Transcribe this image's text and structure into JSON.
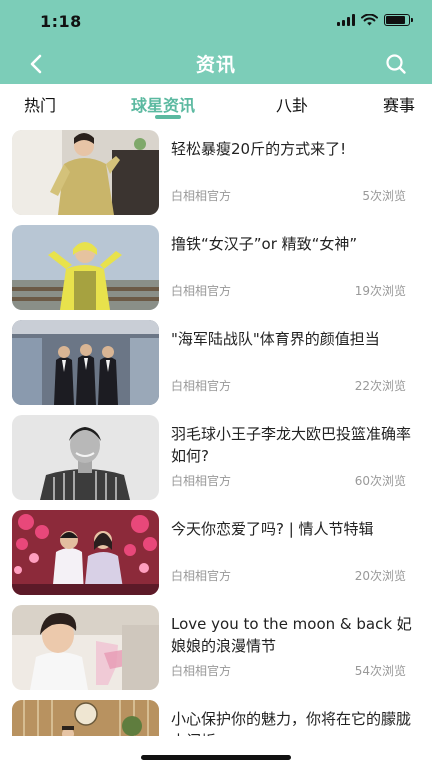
{
  "status_bar": {
    "time": "1:18",
    "battery_level": 0.85
  },
  "header": {
    "title": "资讯",
    "back_icon": "chevron-left-icon",
    "search_icon": "search-icon"
  },
  "tabs": [
    {
      "label": "热门",
      "active": false
    },
    {
      "label": "球星资讯",
      "active": true
    },
    {
      "label": "八卦",
      "active": false
    },
    {
      "label": "赛事",
      "active": false
    }
  ],
  "news": [
    {
      "title": "轻松暴瘦20斤的方式来了!",
      "source": "白相相官方",
      "views": "5次浏览"
    },
    {
      "title": "撸铁“女汉子”or 精致“女神”",
      "source": "白相相官方",
      "views": "19次浏览"
    },
    {
      "title": "\"海军陆战队\"体育界的颜值担当",
      "source": "白相相官方",
      "views": "22次浏览"
    },
    {
      "title": "羽毛球小王子李龙大欧巴投篮准确率如何?",
      "source": "白相相官方",
      "views": "60次浏览"
    },
    {
      "title": "今天你恋爱了吗? | 情人节特辑",
      "source": "白相相官方",
      "views": "20次浏览"
    },
    {
      "title": "Love you to the moon & back 妃娘娘的浪漫情节",
      "source": "白相相官方",
      "views": "54次浏览"
    },
    {
      "title": "小心保护你的魅力，你将在它的朦胧中闪烁",
      "source": "",
      "views": ""
    }
  ],
  "colors": {
    "header": "#7ccdb8",
    "accent": "#5bb9a0"
  }
}
